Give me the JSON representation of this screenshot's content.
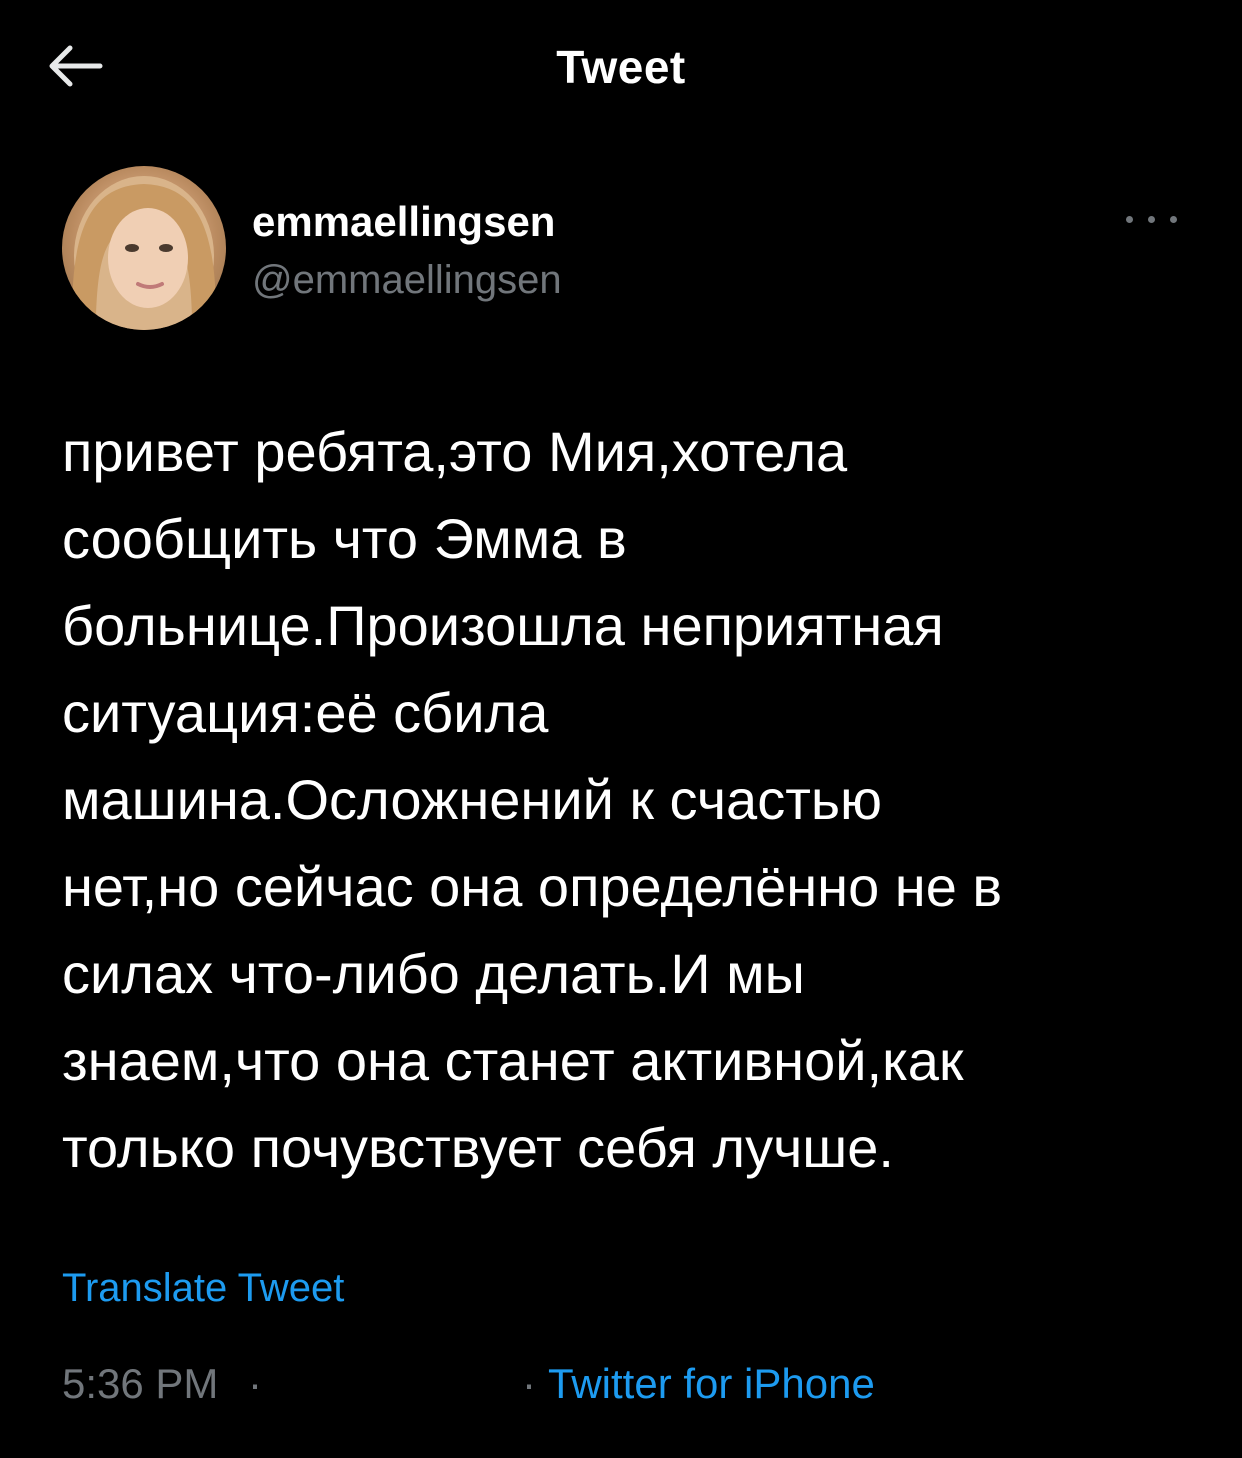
{
  "header": {
    "title": "Tweet",
    "back_icon": "arrow-left-icon"
  },
  "author": {
    "display_name": "emmaellingsen",
    "handle": "@emmaellingsen",
    "more_icon": "more-horizontal-icon"
  },
  "tweet": {
    "text": "привет ребята,это Мия,хотела\nсообщить что Эмма в\nбольнице.Произошла неприятная\nситуация:её сбила\nмашина.Осложнений к счастью\nнет,но сейчас она определённо не в\nсилах что-либо делать.И мы\nзнаем,что она станет активной,как\nтолько почувствует себя лучше.",
    "translate_label": "Translate Tweet",
    "time": "5:36 PM",
    "separator": "·",
    "source": "Twitter for iPhone"
  },
  "colors": {
    "background": "#000000",
    "text": "#ffffff",
    "muted": "#71767b",
    "accent": "#1d9bf0"
  }
}
